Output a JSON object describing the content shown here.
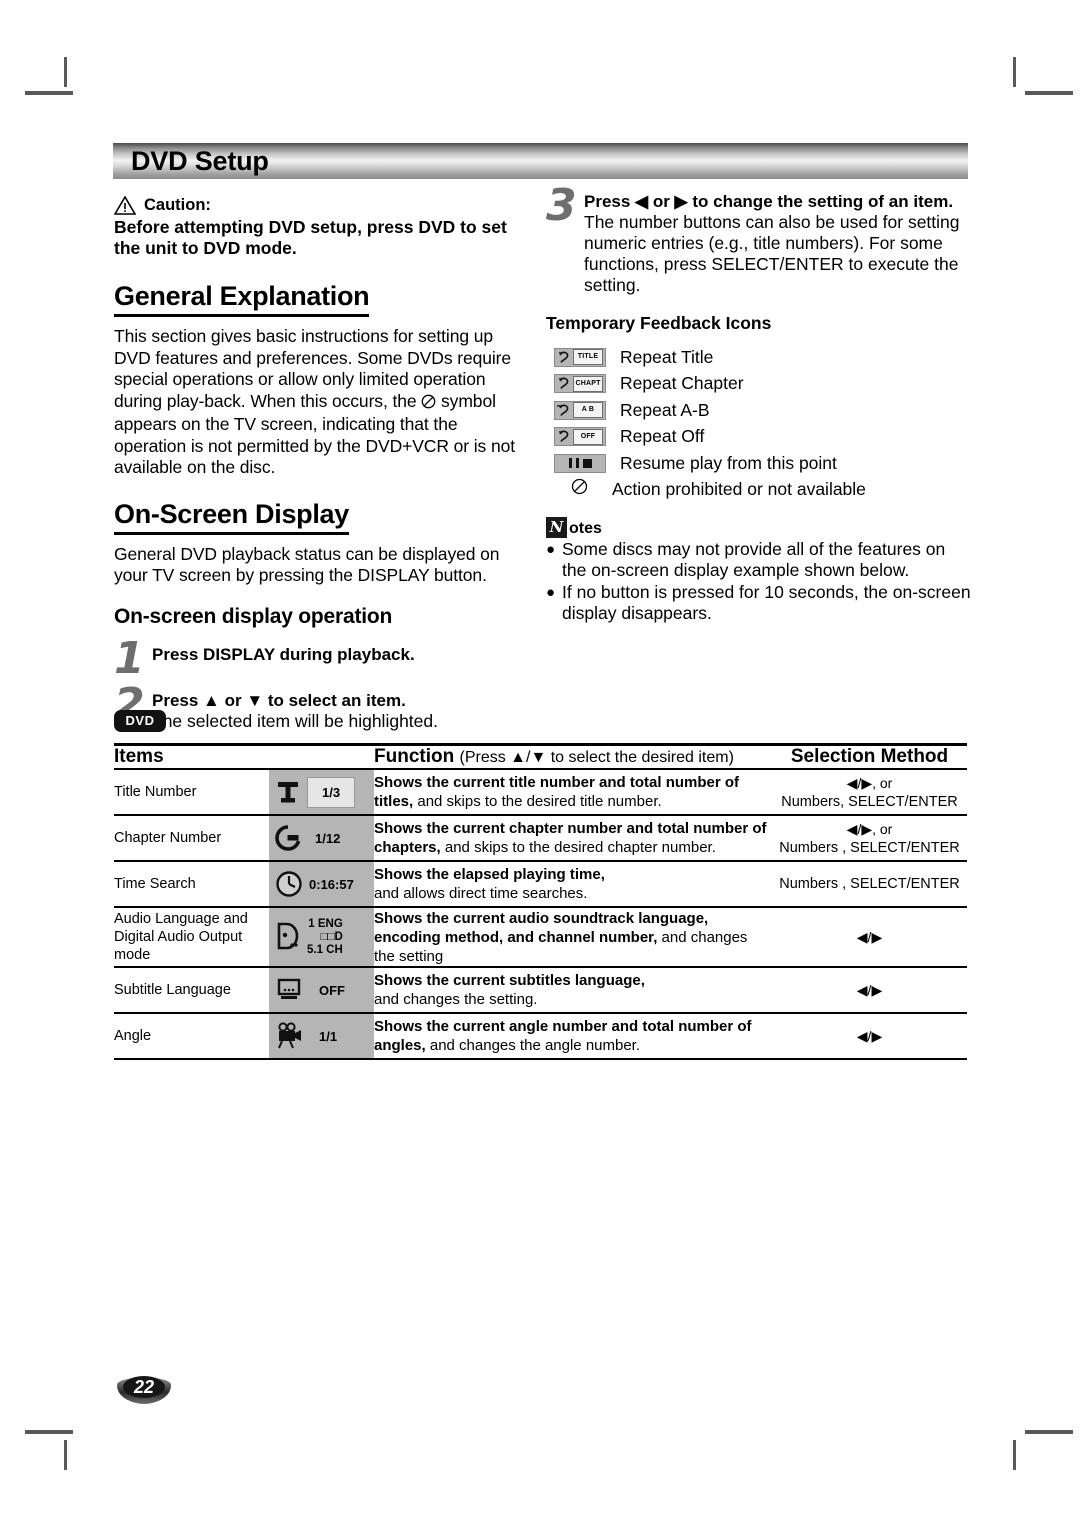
{
  "banner": {
    "title": "DVD Setup"
  },
  "caution": {
    "icon": "warning-triangle-icon",
    "label": "Caution:",
    "body": "Before attempting DVD setup, press DVD to set the unit to DVD mode."
  },
  "general_explanation": {
    "heading": "General Explanation",
    "body_1": "This section gives basic instructions for setting up DVD features and preferences. Some DVDs require special operations or allow only limited operation during play-back. When this occurs, the",
    "body_symbol": "prohibited-icon",
    "body_2": "symbol appears on the TV screen, indicating that the operation is not permitted by the DVD+VCR or is not available on the disc."
  },
  "on_screen_display": {
    "heading": "On-Screen Display",
    "body": "General DVD playback status can be displayed on your TV screen by pressing the DISPLAY button.",
    "subheading": "On-screen display operation",
    "steps": [
      {
        "num": "1",
        "title": "Press DISPLAY during playback.",
        "body": ""
      },
      {
        "num": "2",
        "title": "Press ▲ or ▼ to select an item.",
        "body": "The selected item will be highlighted."
      }
    ]
  },
  "step3": {
    "num": "3",
    "title": "Press ◀ or ▶ to change the setting of an item.",
    "body": "The number buttons can also be used for setting numeric entries (e.g., title numbers). For some functions, press SELECT/ENTER to execute the setting."
  },
  "feedback": {
    "heading": "Temporary Feedback Icons",
    "items": [
      {
        "icon": "repeat-title-icon",
        "tag": "TITLE",
        "label": "Repeat Title"
      },
      {
        "icon": "repeat-chapter-icon",
        "tag": "CHAPT",
        "label": "Repeat Chapter"
      },
      {
        "icon": "repeat-ab-icon",
        "tag": "A  B",
        "label": "Repeat A-B"
      },
      {
        "icon": "repeat-off-icon",
        "tag": "OFF",
        "label": "Repeat Off"
      },
      {
        "icon": "resume-play-icon",
        "tag": "",
        "label": "Resume play from this point"
      },
      {
        "icon": "prohibited-icon",
        "tag": "",
        "label": "Action prohibited or not available"
      }
    ]
  },
  "notes": {
    "badge": "N",
    "word": "otes",
    "items": [
      "Some discs may not provide all of the features on the on-screen display example shown below.",
      "If no button is pressed for 10 seconds, the on-screen display disappears."
    ]
  },
  "table": {
    "badge": "DVD",
    "headers": {
      "items": "Items",
      "function_bold": "Function",
      "function_thin": "(Press ▲/▼ to select the desired item)",
      "selection": "Selection Method"
    },
    "rows": [
      {
        "item": "Title Number",
        "icon": "title-number-icon",
        "value": "1/3",
        "func_bold": "Shows the current title number and total number of",
        "func_bold2": "titles,",
        "func_thin": " and skips to the desired title number.",
        "sel_arrows": "◀/▶, or",
        "sel_text": "Numbers, SELECT/ENTER"
      },
      {
        "item": "Chapter Number",
        "icon": "chapter-number-icon",
        "value": "1/12",
        "func_bold": "Shows the current chapter number and total number of",
        "func_bold2": "chapters,",
        "func_thin": " and skips to the desired chapter number.",
        "sel_arrows": "◀/▶, or",
        "sel_text": "Numbers , SELECT/ENTER"
      },
      {
        "item": "Time Search",
        "icon": "time-search-icon",
        "value": "0:16:57",
        "func_bold": "Shows the elapsed playing time,",
        "func_bold2": "",
        "func_thin": " and allows direct time searches.",
        "sel_arrows": "",
        "sel_text": "Numbers , SELECT/ENTER"
      },
      {
        "item": "Audio Language and Digital Audio Output mode",
        "icon": "audio-language-icon",
        "value": "1  ENG / □□D / 5.1 CH",
        "value_line1": "1   ENG",
        "value_line2": "□□D",
        "value_line3": "5.1 CH",
        "func_bold": "Shows the current audio soundtrack language, encoding method, and channel number,",
        "func_bold2": "",
        "func_thin": " and changes the setting",
        "sel_arrows": "◀/▶",
        "sel_text": ""
      },
      {
        "item": "Subtitle Language",
        "icon": "subtitle-language-icon",
        "value": "OFF",
        "func_bold": "Shows the current subtitles language,",
        "func_bold2": "",
        "func_thin": " and changes the setting.",
        "sel_arrows": "◀/▶",
        "sel_text": ""
      },
      {
        "item": "Angle",
        "icon": "angle-icon",
        "value": "1/1",
        "func_bold": "Shows the current angle number and total number of",
        "func_bold2": "angles,",
        "func_thin": " and changes the angle number.",
        "sel_arrows": "◀/▶",
        "sel_text": ""
      }
    ]
  },
  "footer": {
    "page_number": "22"
  },
  "colors": {
    "osd_gray": "#b5b5b5",
    "step_number_gray": "#6e6e6e",
    "badge_black": "#121212"
  }
}
